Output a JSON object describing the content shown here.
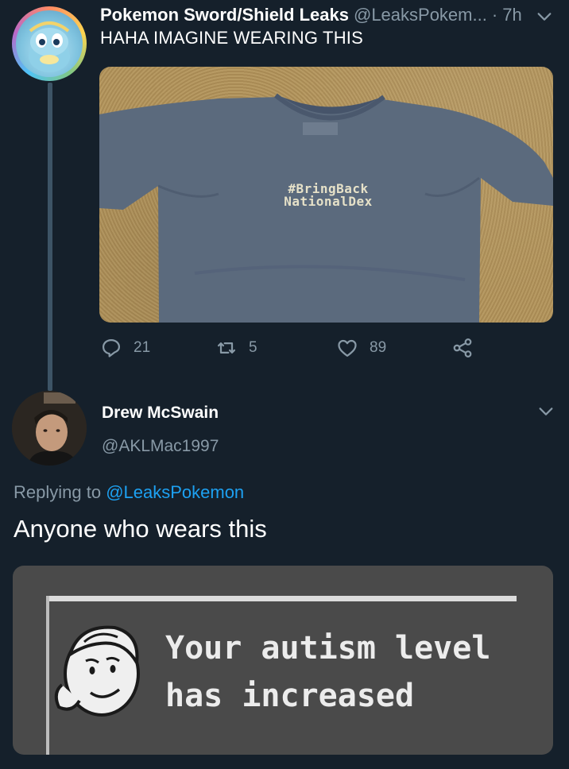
{
  "parent_tweet": {
    "display_name": "Pokemon Sword/Shield Leaks",
    "handle": "@LeaksPokem...",
    "time": "· 7h",
    "text": "HAHA IMAGINE WEARING THIS",
    "media": {
      "shirt_line1": "#BringBack",
      "shirt_line2": "NationalDex"
    },
    "actions": {
      "replies": "21",
      "retweets": "5",
      "likes": "89"
    }
  },
  "reply_tweet": {
    "display_name": "Drew McSwain",
    "handle": "@AKLMac1997",
    "replying_prefix": "Replying to ",
    "replying_mention": "@LeaksPokemon",
    "text": "Anyone who wears this",
    "meme": {
      "line1": "Your autism level",
      "line2": "has increased"
    }
  },
  "colors": {
    "background": "#15202b",
    "secondary_text": "#8899a6",
    "link": "#1da1f2"
  },
  "icons": [
    "chevron-down-icon",
    "reply-icon",
    "retweet-icon",
    "like-icon",
    "share-icon"
  ]
}
